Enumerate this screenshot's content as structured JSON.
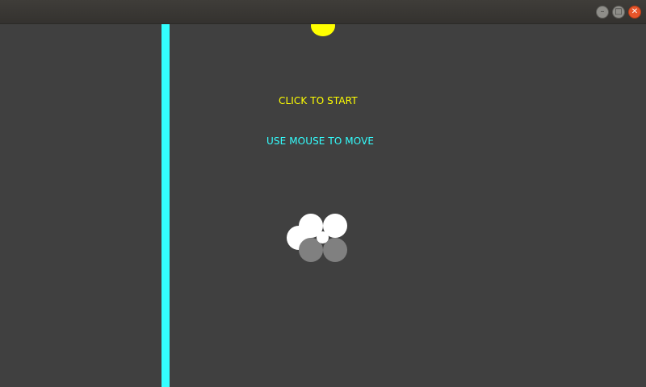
{
  "window": {
    "controls": {
      "minimize_icon": "minimize-icon",
      "maximize_icon": "maximize-icon",
      "close_icon": "close-icon",
      "minimize_glyph": "–",
      "maximize_glyph": "□",
      "close_glyph": "✕"
    }
  },
  "game": {
    "background_color": "#404040",
    "wall_color": "#33ffff",
    "sun_color": "#ffff00",
    "start_message": "CLICK TO START",
    "start_message_color": "#ffff00",
    "instruction_message": "USE MOUSE TO MOVE",
    "instruction_message_color": "#33ffff",
    "cluster": {
      "white_count": 3,
      "gray_count": 2
    }
  }
}
